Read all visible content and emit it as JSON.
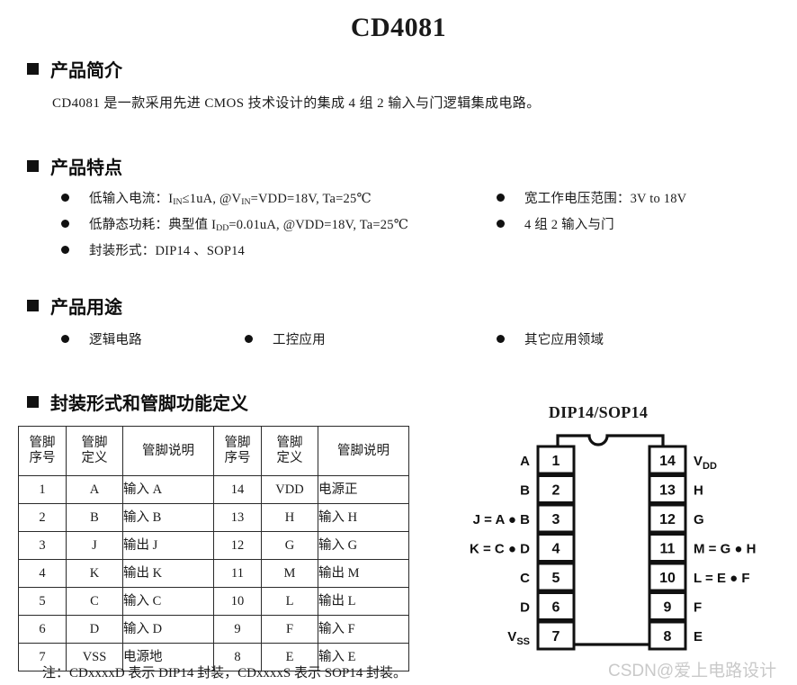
{
  "document": {
    "title": "CD4081",
    "watermark": "CSDN@爱上电路设计"
  },
  "intro": {
    "heading": "产品简介",
    "paragraph": "CD4081 是一款采用先进 CMOS 技术设计的集成 4 组 2 输入与门逻辑集成电路。"
  },
  "features": {
    "heading": "产品特点",
    "left": [
      {
        "prefix": "低输入电流：I",
        "sub1": "IN",
        "mid": "≤1uA, @V",
        "sub2": "IN",
        "suffix": "=VDD=18V, Ta=25℃"
      },
      {
        "prefix": "低静态功耗：典型值 I",
        "sub1": "DD",
        "mid": "=0.01uA, @VDD=18V, Ta=25℃",
        "sub2": "",
        "suffix": ""
      },
      {
        "prefix": "封装形式：DIP14 、SOP14",
        "sub1": "",
        "mid": "",
        "sub2": "",
        "suffix": ""
      }
    ],
    "right": [
      "宽工作电压范围：3V to 18V",
      "4 组 2 输入与门"
    ]
  },
  "applications": {
    "heading": "产品用途",
    "items": [
      "逻辑电路",
      "工控应用",
      "其它应用领域"
    ]
  },
  "pinout": {
    "heading": "封装形式和管脚功能定义",
    "headers": {
      "no_line1": "管脚",
      "no_line2": "序号",
      "def_line1": "管脚",
      "def_line2": "定义",
      "desc": "管脚说明"
    },
    "rows": [
      {
        "no_l": "1",
        "def_l": "A",
        "desc_l": "输入 A",
        "no_r": "14",
        "def_r": "VDD",
        "desc_r": "电源正"
      },
      {
        "no_l": "2",
        "def_l": "B",
        "desc_l": "输入 B",
        "no_r": "13",
        "def_r": "H",
        "desc_r": "输入 H"
      },
      {
        "no_l": "3",
        "def_l": "J",
        "desc_l": "输出 J",
        "no_r": "12",
        "def_r": "G",
        "desc_r": "输入 G"
      },
      {
        "no_l": "4",
        "def_l": "K",
        "desc_l": "输出 K",
        "no_r": "11",
        "def_r": "M",
        "desc_r": "输出 M"
      },
      {
        "no_l": "5",
        "def_l": "C",
        "desc_l": "输入 C",
        "no_r": "10",
        "def_r": "L",
        "desc_r": "输出 L"
      },
      {
        "no_l": "6",
        "def_l": "D",
        "desc_l": "输入 D",
        "no_r": "9",
        "def_r": "F",
        "desc_r": "输入 F"
      },
      {
        "no_l": "7",
        "def_l": "VSS",
        "desc_l": "电源地",
        "no_r": "8",
        "def_r": "E",
        "desc_r": "输入 E"
      }
    ],
    "note": "注：CDxxxxD 表示 DIP14 封装，CDxxxxS 表示 SOP14 封装。"
  },
  "package_diagram": {
    "title": "DIP14/SOP14",
    "left_pins": [
      {
        "number": "1",
        "label": "A"
      },
      {
        "number": "2",
        "label": "B"
      },
      {
        "number": "3",
        "label": "J = A ● B"
      },
      {
        "number": "4",
        "label": "K = C ● D"
      },
      {
        "number": "5",
        "label": "C"
      },
      {
        "number": "6",
        "label": "D"
      },
      {
        "number": "7",
        "label": "VSS",
        "label_sub": "SS",
        "label_main": "V"
      }
    ],
    "right_pins": [
      {
        "number": "14",
        "label": "VDD",
        "label_main": "V",
        "label_sub": "DD"
      },
      {
        "number": "13",
        "label": "H"
      },
      {
        "number": "12",
        "label": "G"
      },
      {
        "number": "11",
        "label": "M = G ● H"
      },
      {
        "number": "10",
        "label": "L = E ● F"
      },
      {
        "number": "9",
        "label": "F"
      },
      {
        "number": "8",
        "label": "E"
      }
    ]
  }
}
